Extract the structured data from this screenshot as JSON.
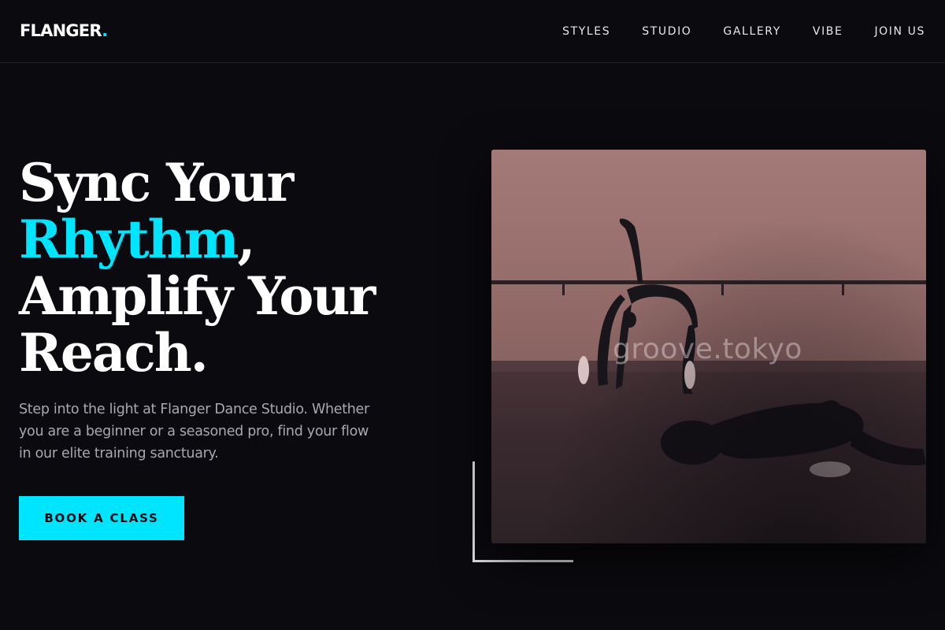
{
  "header": {
    "logo_text": "FLANGER",
    "logo_dot": ".",
    "nav": [
      "STYLES",
      "STUDIO",
      "GALLERY",
      "VIBE",
      "JOIN US"
    ]
  },
  "hero": {
    "headline_line1": "Sync Your",
    "headline_accent": "Rhythm",
    "headline_comma": ",",
    "headline_line3": "Amplify Your",
    "headline_line4": "Reach.",
    "subtext": "Step into the light at Flanger Dance Studio. Whether you are a beginner or a seasoned pro, find your flow in our elite training sanctuary.",
    "cta_label": "BOOK A CLASS"
  },
  "image": {
    "watermark": "groove.tokyo"
  },
  "colors": {
    "accent": "#00e5ff",
    "background": "#0b0a0f"
  }
}
